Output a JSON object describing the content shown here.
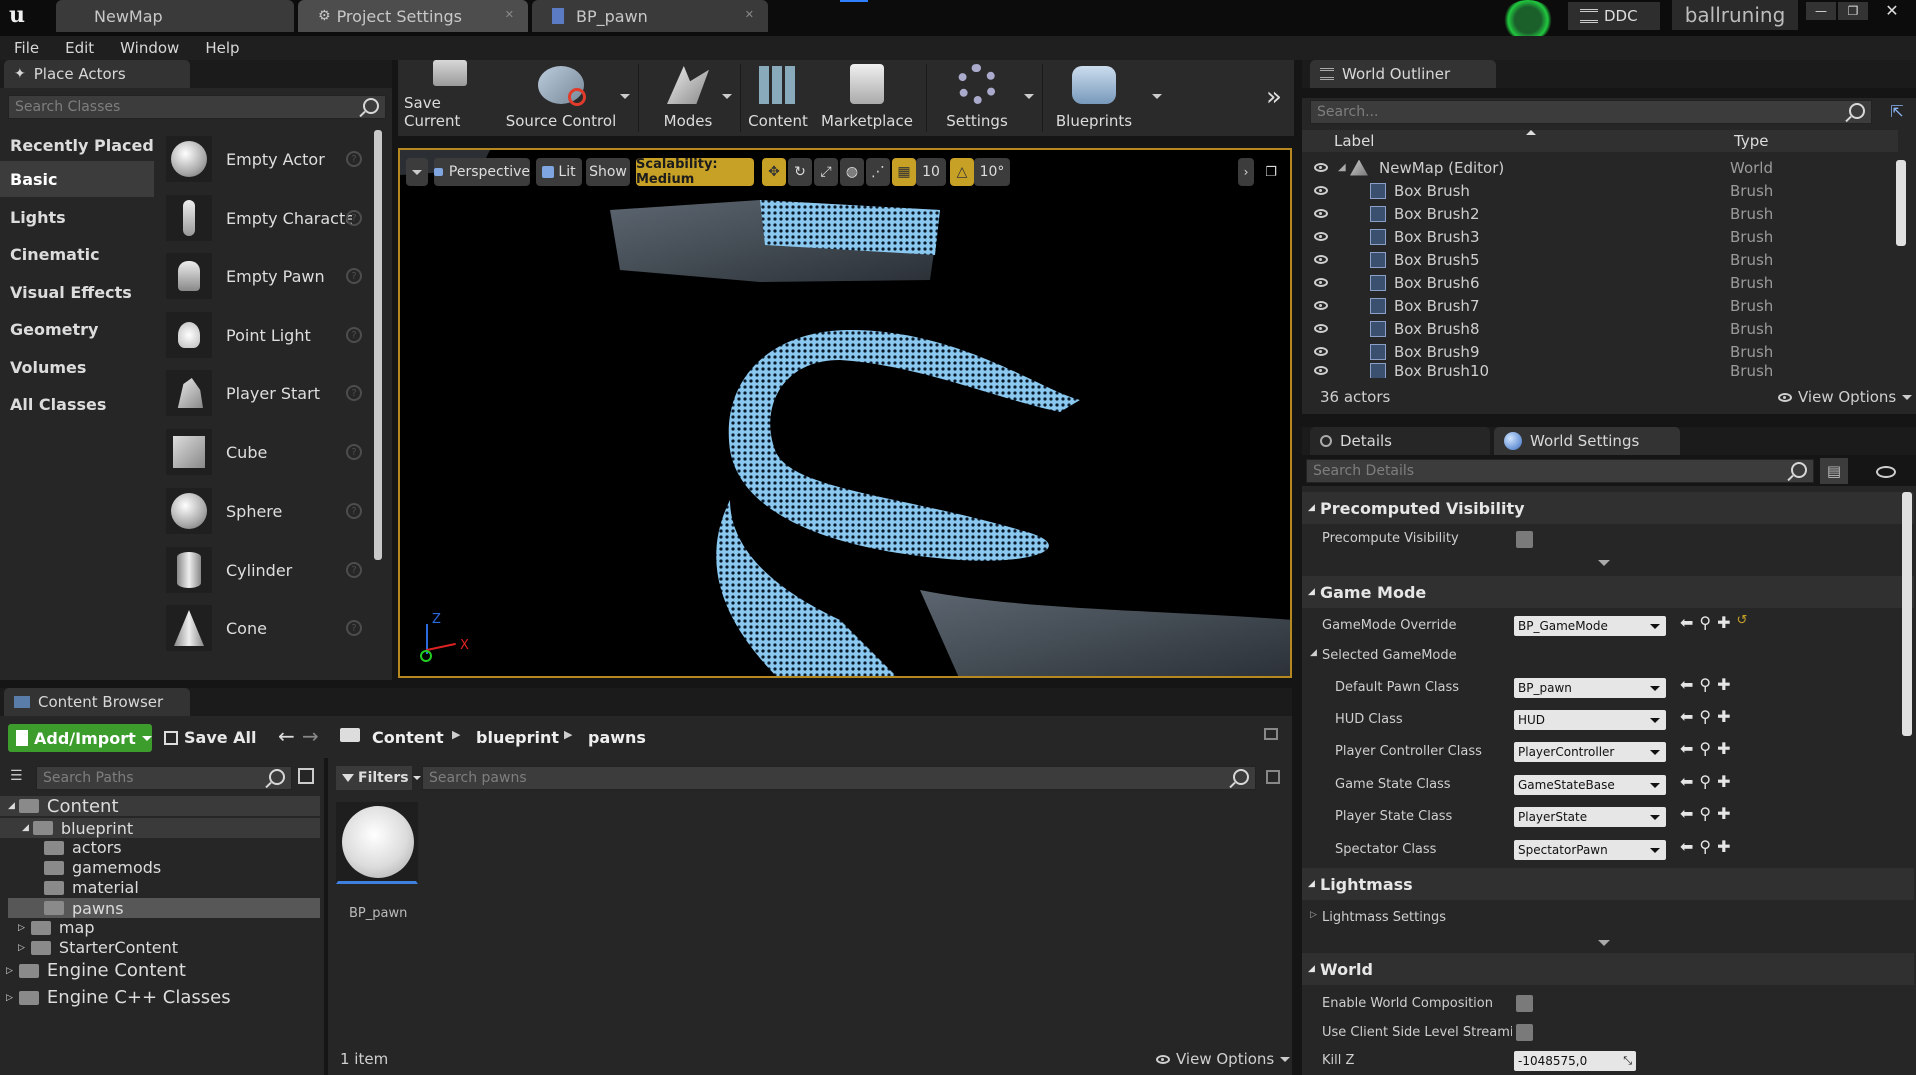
{
  "tabs": [
    {
      "label": "NewMap"
    },
    {
      "label": "Project Settings"
    },
    {
      "label": "BP_pawn"
    }
  ],
  "titlebar": {
    "ddc": "DDC",
    "project": "ballruning"
  },
  "menu": [
    "File",
    "Edit",
    "Window",
    "Help"
  ],
  "place_actors": {
    "title": "Place Actors",
    "search_placeholder": "Search Classes",
    "categories": [
      "Recently Placed",
      "Basic",
      "Lights",
      "Cinematic",
      "Visual Effects",
      "Geometry",
      "Volumes",
      "All Classes"
    ],
    "active_category": "Basic",
    "actors": [
      "Empty Actor",
      "Empty Characte",
      "Empty Pawn",
      "Point Light",
      "Player Start",
      "Cube",
      "Sphere",
      "Cylinder",
      "Cone"
    ]
  },
  "toolbar": {
    "buttons": [
      "Save Current",
      "Source Control",
      "Modes",
      "Content",
      "Marketplace",
      "Settings",
      "Blueprints"
    ]
  },
  "viewport": {
    "perspective": "Perspective",
    "lit": "Lit",
    "show": "Show",
    "scalability": "Scalability: Medium",
    "grid_snap": "10",
    "rotation_snap": "10°",
    "axis_z": "Z",
    "axis_x": "X"
  },
  "outliner": {
    "title": "World Outliner",
    "search_placeholder": "Search...",
    "col_label": "Label",
    "col_type": "Type",
    "root": {
      "label": "NewMap (Editor)",
      "type": "World"
    },
    "rows": [
      {
        "label": "Box Brush",
        "type": "Brush"
      },
      {
        "label": "Box Brush2",
        "type": "Brush"
      },
      {
        "label": "Box Brush3",
        "type": "Brush"
      },
      {
        "label": "Box Brush5",
        "type": "Brush"
      },
      {
        "label": "Box Brush6",
        "type": "Brush"
      },
      {
        "label": "Box Brush7",
        "type": "Brush"
      },
      {
        "label": "Box Brush8",
        "type": "Brush"
      },
      {
        "label": "Box Brush9",
        "type": "Brush"
      },
      {
        "label": "Box Brush10",
        "type": "Brush"
      }
    ],
    "count": "36 actors",
    "view_options": "View Options"
  },
  "details": {
    "tab_details": "Details",
    "tab_world": "World Settings",
    "search_placeholder": "Search Details",
    "sec_precomputed": "Precomputed Visibility",
    "precompute_visibility": "Precompute Visibility",
    "sec_gamemode": "Game Mode",
    "gamemode_override": "GameMode Override",
    "gamemode_override_value": "BP_GameMode",
    "selected_gamemode": "Selected GameMode",
    "props": [
      {
        "label": "Default Pawn Class",
        "value": "BP_pawn"
      },
      {
        "label": "HUD Class",
        "value": "HUD"
      },
      {
        "label": "Player Controller Class",
        "value": "PlayerController"
      },
      {
        "label": "Game State Class",
        "value": "GameStateBase"
      },
      {
        "label": "Player State Class",
        "value": "PlayerState"
      },
      {
        "label": "Spectator Class",
        "value": "SpectatorPawn"
      }
    ],
    "sec_lightmass": "Lightmass",
    "lightmass_settings": "Lightmass Settings",
    "sec_world": "World",
    "enable_world_composition": "Enable World Composition",
    "client_streaming": "Use Client Side Level Streaming",
    "kill_z": "Kill Z",
    "kill_z_value": "-1048575,0"
  },
  "content_browser": {
    "title": "Content Browser",
    "add_import": "Add/Import",
    "save_all": "Save All",
    "path": [
      "Content",
      "blueprint",
      "pawns"
    ],
    "search_paths": "Search Paths",
    "filters": "Filters",
    "search_placeholder": "Search pawns",
    "tree": [
      {
        "label": "Content",
        "level": 0
      },
      {
        "label": "blueprint",
        "level": 1
      },
      {
        "label": "actors",
        "level": 2
      },
      {
        "label": "gamemods",
        "level": 2
      },
      {
        "label": "material",
        "level": 2
      },
      {
        "label": "pawns",
        "level": 2
      },
      {
        "label": "map",
        "level": 1
      },
      {
        "label": "StarterContent",
        "level": 1
      },
      {
        "label": "Engine Content",
        "level": 0
      },
      {
        "label": "Engine C++ Classes",
        "level": 0
      }
    ],
    "asset": "BP_pawn",
    "item_count": "1 item",
    "view_options": "View Options"
  }
}
